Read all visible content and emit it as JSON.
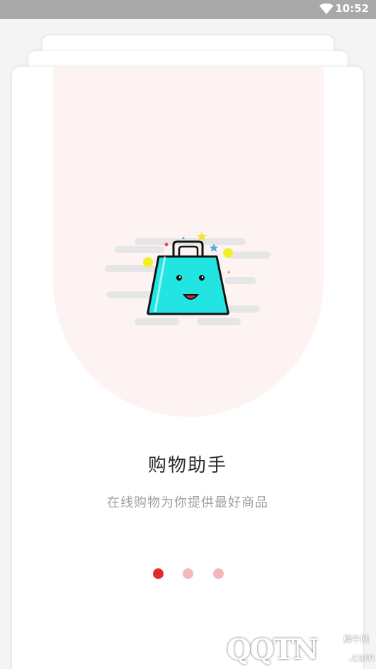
{
  "status_bar": {
    "time": "10:52",
    "wifi_icon": "wifi-icon"
  },
  "onboarding": {
    "title": "购物助手",
    "subtitle": "在线购物为你提供最好商品",
    "illustration_icon": "shopping-bag-icon",
    "pages": 3,
    "active_page": 1,
    "colors": {
      "active_dot": "#e02b2b",
      "inactive_dot": "#f5b8b8",
      "bag": "#22e5e3",
      "arch": "#fdf3f2"
    }
  },
  "watermark": {
    "cn": "腾牛网",
    "logo": "QQTN",
    "com": ".com"
  }
}
